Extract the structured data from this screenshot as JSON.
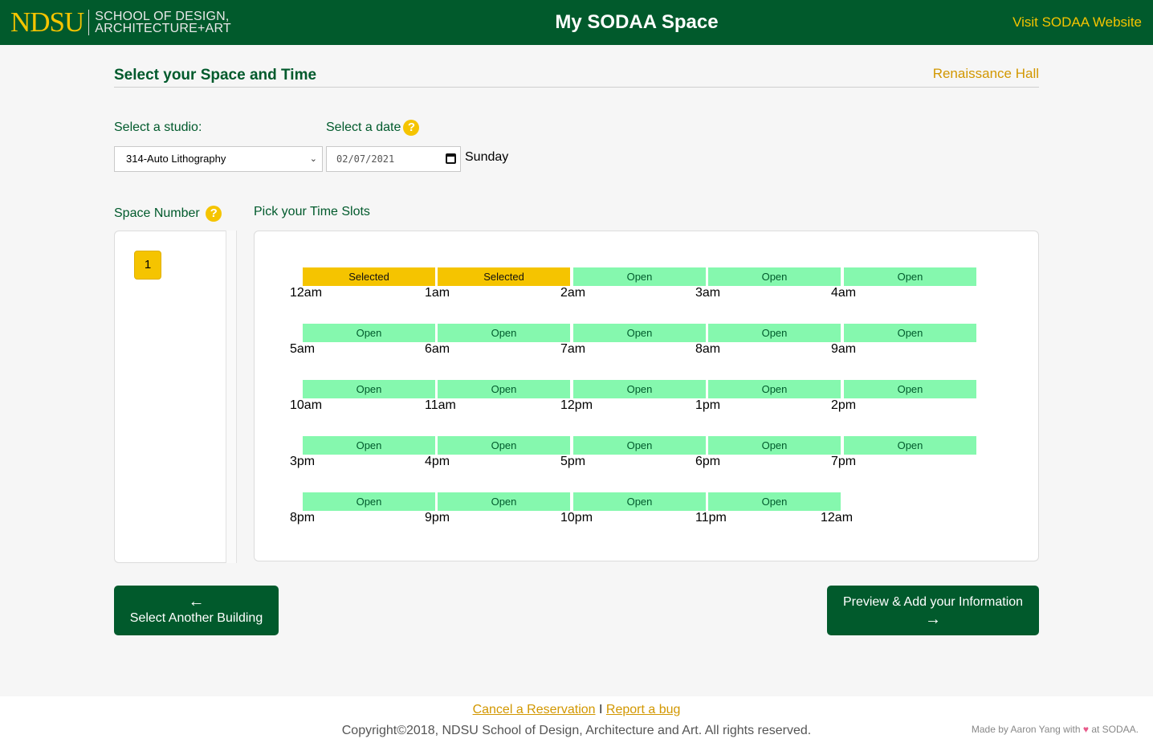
{
  "header": {
    "logo_ndsu": "NDSU",
    "logo_school_line1": "SCHOOL OF DESIGN,",
    "logo_school_line2": "ARCHITECTURE+ART",
    "title": "My SODAA Space",
    "visit_link": "Visit SODAA Website"
  },
  "main": {
    "section_title": "Select your Space and Time",
    "building": "Renaissance Hall",
    "studio_label": "Select a studio:",
    "studio_value": "314-Auto Lithography",
    "date_label": "Select a date",
    "date_value": "02/07/2021",
    "day_name": "Sunday",
    "space_label": "Space Number",
    "space_numbers": [
      "1"
    ],
    "slots_label": "Pick your Time Slots"
  },
  "help_icon": "?",
  "slot_rows": [
    {
      "labels": [
        "12am",
        "1am",
        "2am",
        "3am",
        "4am"
      ],
      "slots": [
        "Selected",
        "Selected",
        "Open",
        "Open",
        "Open"
      ]
    },
    {
      "labels": [
        "5am",
        "6am",
        "7am",
        "8am",
        "9am"
      ],
      "slots": [
        "Open",
        "Open",
        "Open",
        "Open",
        "Open"
      ]
    },
    {
      "labels": [
        "10am",
        "11am",
        "12pm",
        "1pm",
        "2pm"
      ],
      "slots": [
        "Open",
        "Open",
        "Open",
        "Open",
        "Open"
      ]
    },
    {
      "labels": [
        "3pm",
        "4pm",
        "5pm",
        "6pm",
        "7pm"
      ],
      "slots": [
        "Open",
        "Open",
        "Open",
        "Open",
        "Open"
      ]
    },
    {
      "labels": [
        "8pm",
        "9pm",
        "10pm",
        "11pm",
        "12am"
      ],
      "slots": [
        "Open",
        "Open",
        "Open",
        "Open"
      ]
    }
  ],
  "buttons": {
    "back_label": "Select Another Building",
    "next_label": "Preview & Add your Information"
  },
  "icons": {
    "back": "arrow-left-icon",
    "next": "arrow-right-icon",
    "help": "question-icon",
    "calendar": "calendar-icon"
  },
  "footer": {
    "cancel_link": "Cancel a Reservation",
    "separator": "I",
    "bug_link": "Report a bug",
    "copyright": "Copyright©2018, NDSU School of Design, Architecture and Art. All rights reserved.",
    "made_by_prefix": "Made by Aaron Yang with",
    "made_by_suffix": "at SODAA."
  },
  "colors": {
    "brand_green": "#015a2c",
    "brand_yellow": "#f5c400",
    "open_slot": "#85f8ae",
    "link_gold": "#d29700"
  }
}
